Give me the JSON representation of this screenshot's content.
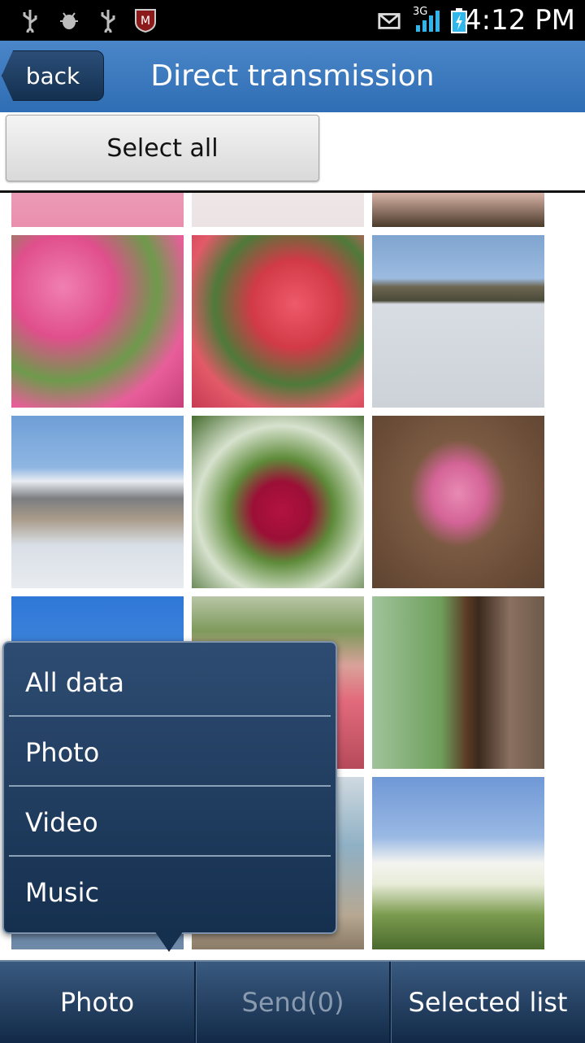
{
  "status_bar": {
    "time": "4:12 PM",
    "network": "3G",
    "icons": [
      "usb-icon",
      "debug-icon",
      "usb-icon",
      "mcafee-icon",
      "notification-icon",
      "signal-icon",
      "battery-icon"
    ]
  },
  "header": {
    "back_label": "back",
    "title": "Direct transmission"
  },
  "toolbar": {
    "select_all_label": "Select all"
  },
  "popup_menu": {
    "items": [
      {
        "label": "All data"
      },
      {
        "label": "Photo"
      },
      {
        "label": "Video"
      },
      {
        "label": "Music"
      }
    ]
  },
  "bottom_bar": {
    "type_label": "Photo",
    "send_label": "Send(0)",
    "selected_list_label": "Selected list"
  },
  "colors": {
    "header": "#2f6db4",
    "popup": "#1e3a5f",
    "bottom_bar": "#1f3b5e"
  }
}
